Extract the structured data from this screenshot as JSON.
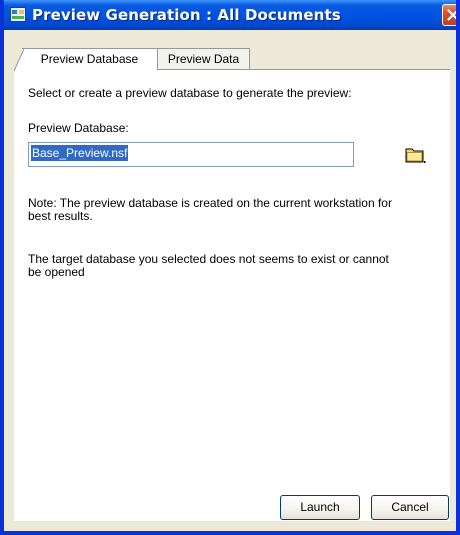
{
  "window": {
    "title": "Preview Generation : All Documents",
    "title_icon": "preview-generation-icon",
    "close_icon": "close-icon"
  },
  "tabs": [
    {
      "label": "Preview Database",
      "active": true
    },
    {
      "label": "Preview Data",
      "active": false
    }
  ],
  "panel": {
    "instruction": "Select or create a preview database to generate the preview:",
    "field_label": "Preview Database:",
    "field_value": "Base_Preview.nsf",
    "browse_icon": "folder-icon",
    "note_line1": "Note: The preview database is created on the current workstation for",
    "note_line2": "best results.",
    "error_line1": "The target database you selected does not seems to exist or cannot",
    "error_line2": "be opened"
  },
  "buttons": {
    "launch": "Launch",
    "cancel": "Cancel"
  },
  "colors": {
    "titlebar": "#0054e3",
    "dialog_bg": "#ece9d8",
    "selection": "#316ac5",
    "close_button": "#d4512e"
  }
}
